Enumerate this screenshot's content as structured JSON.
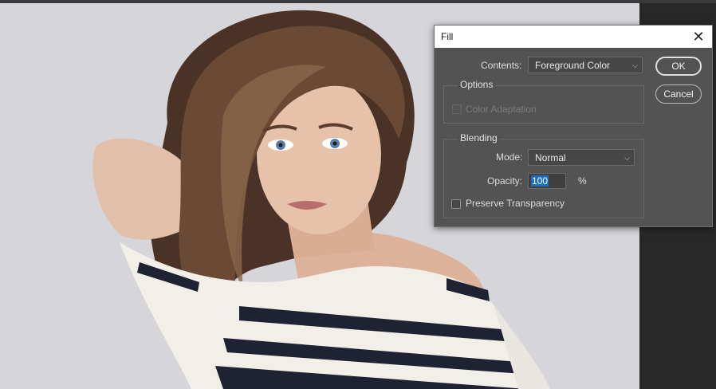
{
  "dialog": {
    "title": "Fill",
    "close_glyph": "✕",
    "contents_label": "Contents:",
    "contents_value": "Foreground Color",
    "ok_label": "OK",
    "cancel_label": "Cancel",
    "options": {
      "title": "Options",
      "color_adaptation_label": "Color Adaptation",
      "color_adaptation_checked": false,
      "color_adaptation_enabled": false
    },
    "blending": {
      "title": "Blending",
      "mode_label": "Mode:",
      "mode_value": "Normal",
      "opacity_label": "Opacity:",
      "opacity_value": "100",
      "opacity_unit": "%",
      "preserve_transparency_label": "Preserve Transparency",
      "preserve_transparency_checked": false
    }
  },
  "icons": {
    "close": "close-icon",
    "dropdown": "chevron-down-icon"
  },
  "colors": {
    "dialog_bg": "#535353",
    "titlebar_bg": "#ffffff",
    "selection": "#1e6ec0"
  }
}
